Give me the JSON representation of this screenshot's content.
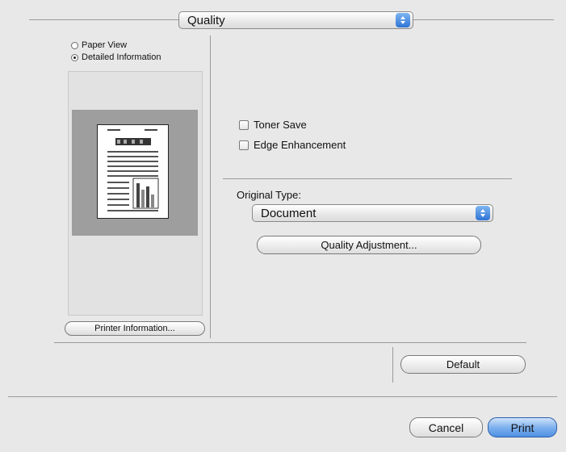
{
  "header": {
    "panel_popup": "Quality"
  },
  "preview_mode": {
    "options": [
      {
        "label": "Paper View",
        "selected": false
      },
      {
        "label": "Detailed Information",
        "selected": true
      }
    ]
  },
  "preview": {
    "printer_info_button": "Printer Information..."
  },
  "options": {
    "toner_save": {
      "label": "Toner Save",
      "checked": false
    },
    "edge_enhancement": {
      "label": "Edge Enhancement",
      "checked": false
    }
  },
  "original_type": {
    "label": "Original Type:",
    "value": "Document",
    "adjust_button": "Quality Adjustment..."
  },
  "buttons": {
    "default": "Default",
    "cancel": "Cancel",
    "print": "Print"
  },
  "colors": {
    "accent_blue": "#3e82e0"
  }
}
